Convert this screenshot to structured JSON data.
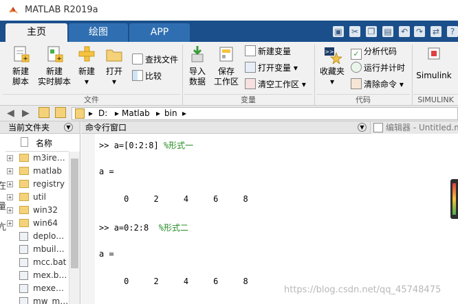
{
  "window": {
    "title": "MATLAB R2019a"
  },
  "tabs": [
    {
      "label": "主页",
      "active": true
    },
    {
      "label": "绘图",
      "active": false
    },
    {
      "label": "APP",
      "active": false
    }
  ],
  "ribbon": {
    "file_group": {
      "label": "文件",
      "new_script": [
        "新建",
        "脚本"
      ],
      "new_live_script": [
        "新建",
        "实时脚本"
      ],
      "new": "新建",
      "open": "打开",
      "find_files": "查找文件",
      "compare": "比较"
    },
    "variable_group": {
      "label": "变量",
      "import_data": [
        "导入",
        "数据"
      ],
      "save_workspace": [
        "保存",
        "工作区"
      ],
      "new_variable": "新建变量",
      "open_variable": "打开变量",
      "clear_workspace": "清空工作区"
    },
    "code_group": {
      "label": "代码",
      "favorites": "收藏夹",
      "analyze_code": "分析代码",
      "run_and_time": "运行并计时",
      "clear_commands": "清除命令"
    },
    "simulink_group": {
      "label": "SIMULINK",
      "simulink": "Simulink"
    }
  },
  "address_bar": {
    "path": [
      "D:",
      "Matlab",
      "bin"
    ]
  },
  "current_folder": {
    "title": "当前文件夹",
    "column_header": "名称",
    "items": [
      {
        "name": "m3ire…",
        "type": "folder"
      },
      {
        "name": "matlab",
        "type": "folder"
      },
      {
        "name": "registry",
        "type": "folder"
      },
      {
        "name": "util",
        "type": "folder"
      },
      {
        "name": "win32",
        "type": "folder"
      },
      {
        "name": "win64",
        "type": "folder"
      },
      {
        "name": "deplo…",
        "type": "file"
      },
      {
        "name": "mbuil…",
        "type": "file"
      },
      {
        "name": "mcc.bat",
        "type": "file"
      },
      {
        "name": "mex.b…",
        "type": "file"
      },
      {
        "name": "mexe…",
        "type": "file"
      },
      {
        "name": "mw_m…",
        "type": "file"
      }
    ],
    "left_edge_glyphs": [
      "在",
      "量",
      "亢"
    ]
  },
  "command_window": {
    "title": "命令行窗口",
    "editor_tab": "编辑器 - Untitled.m",
    "lines": [
      {
        "prompt": ">> ",
        "code": "a=[0:2:8] ",
        "comment": "%形式一"
      },
      {
        "text": "a ="
      },
      {
        "text": "     0     2     4     6     8"
      },
      {
        "prompt": ">> ",
        "code": "a=0:2:8  ",
        "comment": "%形式二"
      },
      {
        "text": "a ="
      },
      {
        "text": "     0     2     4     6     8"
      }
    ]
  },
  "watermark": "https://blog.csdn.net/qq_45748475",
  "colors": {
    "ribbon_blue": "#1a4f8b",
    "active_tab": "#f1f1f1",
    "comment_green": "#228b22"
  }
}
